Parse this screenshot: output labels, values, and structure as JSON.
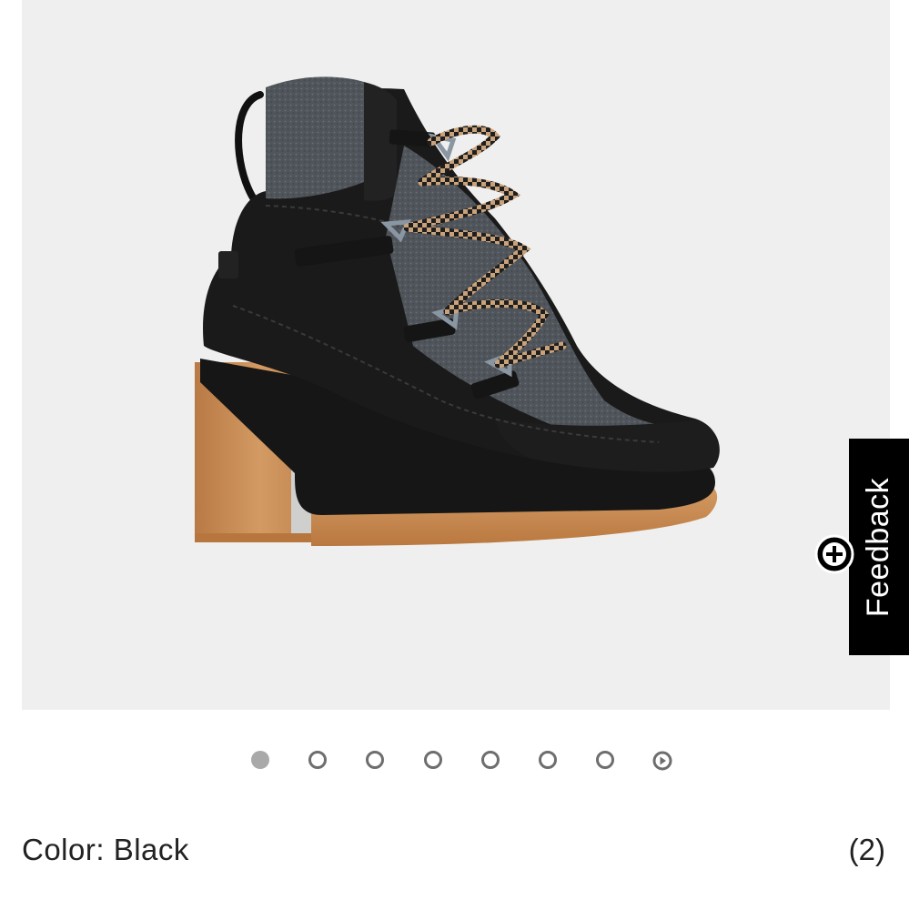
{
  "product": {
    "image_alt": "Black heeled lace-up boot with grey felt panels and gum heel",
    "color_label": "Color: Black",
    "review_count": "(2)"
  },
  "carousel": {
    "total_slides": 7,
    "active_index": 0,
    "has_video": true
  },
  "feedback": {
    "label": "Feedback"
  },
  "colors": {
    "panel_bg": "#efefef",
    "boot_black": "#1a1a1a",
    "felt_grey": "#555a60",
    "heel_gum": "#c98a55",
    "feedback_bg": "#000000"
  }
}
